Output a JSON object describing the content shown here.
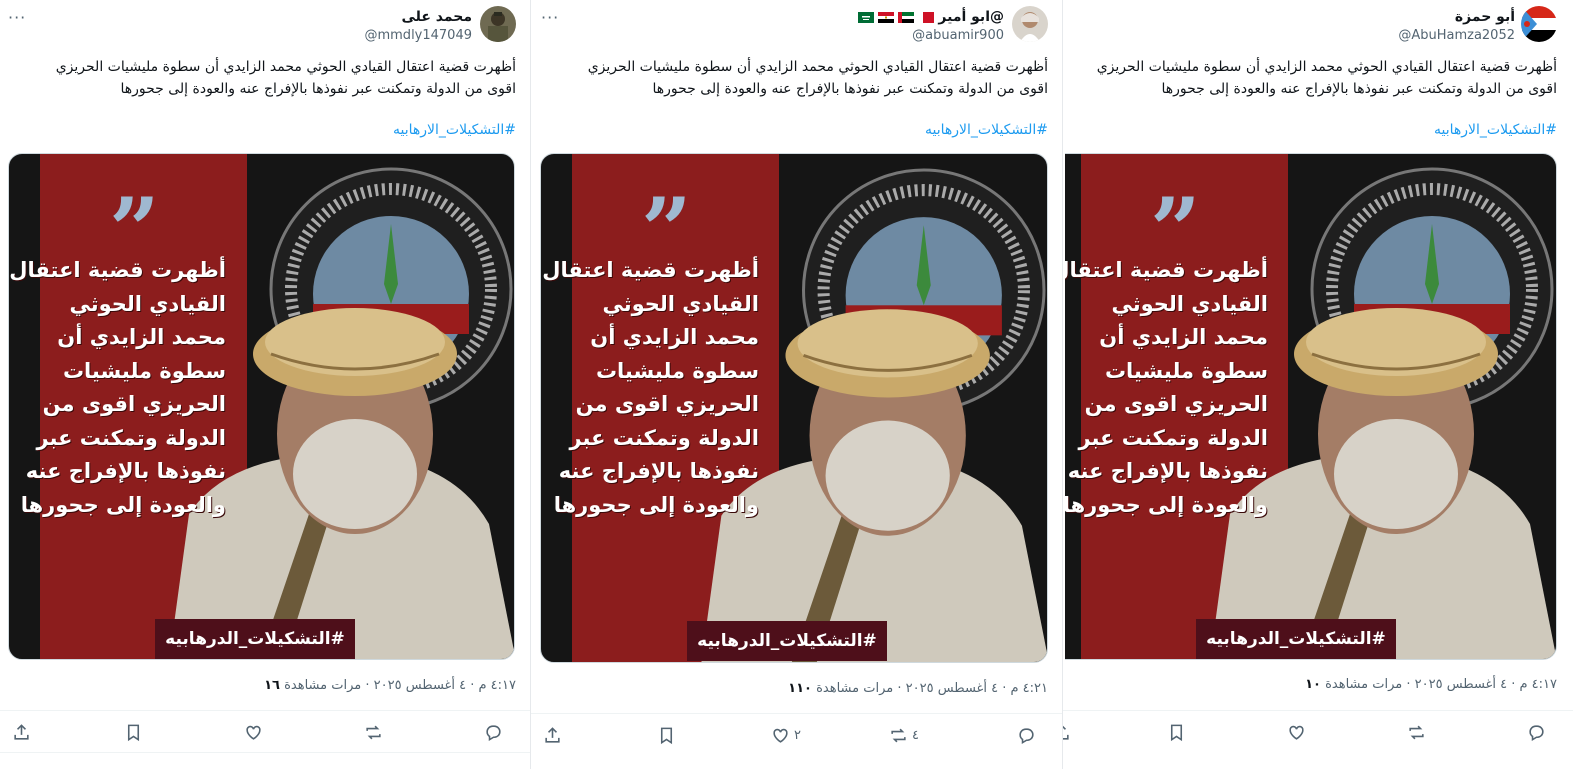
{
  "tweets": [
    {
      "display_name": "محمد على",
      "handle": "@mmdly147049",
      "flags": [],
      "text_line1": "أظهرت قضية اعتقال القيادي الحوثي محمد الزايدي أن سطوة مليشيات الحريزي",
      "text_line2": "اقوى من الدولة وتمكنت عبر نفوذها بالإفراج عنه والعودة إلى جحورها",
      "hashtag": "#التشكيلات_الارهابيه",
      "poster_lines": [
        "أظهرت قضية اعتقال",
        "القيادي الحوثي",
        "محمد الزايدي أن",
        "سطوة مليشيات",
        "الحريزي اقوى من",
        "الدولة وتمكنت عبر",
        "نفوذها بالإفراج عنه",
        "والعودة إلى جحورها"
      ],
      "poster_tag": "#التشكيلات_الدرهابيه",
      "time": "٤:١٧ م",
      "date": "٤ أغسطس ٢٠٢٥",
      "views_count": "١٦",
      "views_label": "مرات مشاهدة",
      "reply_count": "",
      "retweet_count": "",
      "like_count": ""
    },
    {
      "display_name": "@ابو أمير",
      "handle": "@abuamir900",
      "flags": [
        "saudi",
        "egypt",
        "uae",
        "bahrain"
      ],
      "text_line1": "أظهرت قضية اعتقال القيادي الحوثي محمد الزايدي أن سطوة مليشيات الحريزي",
      "text_line2": "اقوى من الدولة وتمكنت عبر نفوذها بالإفراج عنه والعودة إلى جحورها",
      "hashtag": "#التشكيلات_الارهابيه",
      "poster_lines": [
        "أظهرت قضية اعتقال",
        "القيادي الحوثي",
        "محمد الزايدي أن",
        "سطوة مليشيات",
        "الحريزي اقوى من",
        "الدولة وتمكنت عبر",
        "نفوذها بالإفراج عنه",
        "والعودة إلى جحورها"
      ],
      "poster_tag": "#التشكيلات_الدرهابيه",
      "time": "٤:٢١ م",
      "date": "٤ أغسطس ٢٠٢٥",
      "views_count": "١١٠",
      "views_label": "مرات مشاهدة",
      "reply_count": "",
      "retweet_count": "٤",
      "like_count": "٢"
    },
    {
      "display_name": "أبو حمزة",
      "handle": "@AbuHamza2052",
      "flags": [],
      "text_line1": "أظهرت قضية اعتقال القيادي الحوثي محمد الزايدي أن سطوة مليشيات الحريزي",
      "text_line2": "اقوى من الدولة وتمكنت عبر نفوذها بالإفراج عنه والعودة إلى جحورها",
      "hashtag": "#التشكيلات_الارهابيه",
      "poster_lines": [
        "أظهرت قضية اعتقال",
        "القيادي الحوثي",
        "محمد الزايدي أن",
        "سطوة مليشيات",
        "الحريزي اقوى من",
        "الدولة وتمكنت عبر",
        "نفوذها بالإفراج عنه",
        "والعودة إلى جحورها"
      ],
      "poster_tag": "#التشكيلات_الدرهابيه",
      "time": "٤:١٧ م",
      "date": "٤ أغسطس ٢٠٢٥",
      "views_count": "١٠",
      "views_label": "مرات مشاهدة",
      "reply_count": "",
      "retweet_count": "",
      "like_count": ""
    }
  ],
  "colors": {
    "link_blue": "#1d9bf0",
    "poster_red": "#8c1d1d",
    "poster_tag_bg": "#4e0f1a",
    "muted_text": "#536471"
  },
  "icons": {
    "more": "more-horizontal-icon",
    "reply": "reply-icon",
    "retweet": "retweet-icon",
    "like": "heart-icon",
    "bookmark": "bookmark-icon",
    "share": "share-icon"
  }
}
